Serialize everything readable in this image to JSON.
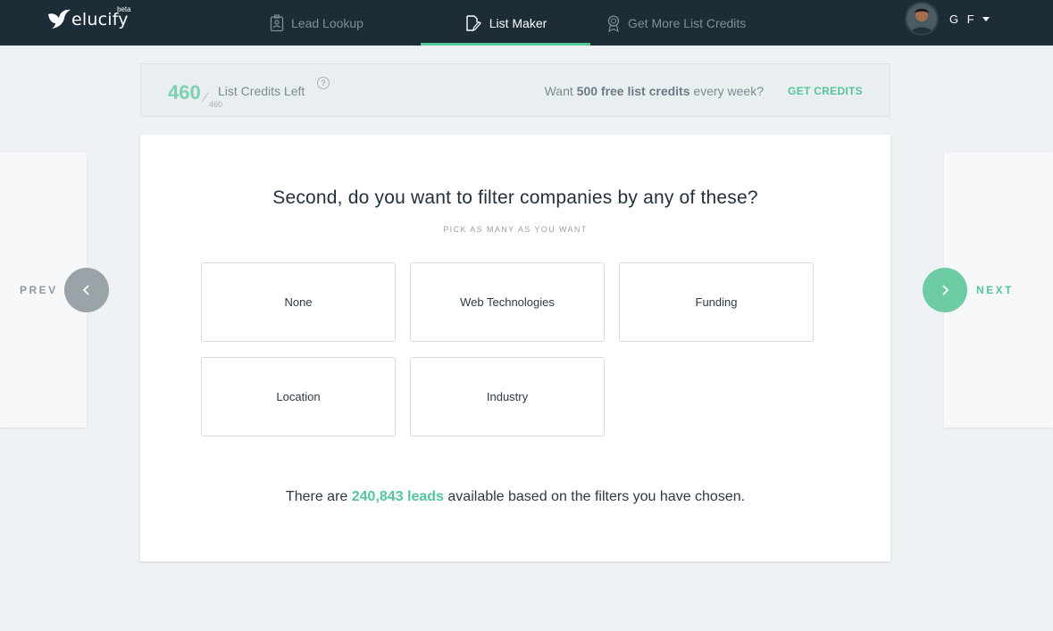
{
  "brand": {
    "name": "elucify",
    "badge": "beta"
  },
  "nav": [
    {
      "label": "Lead Lookup",
      "icon": "badge-icon"
    },
    {
      "label": "List Maker",
      "icon": "edit-list-icon",
      "active": true
    },
    {
      "label": "Get More List Credits",
      "icon": "award-icon"
    }
  ],
  "user": {
    "initials": "G F"
  },
  "credits": {
    "left": "460",
    "total": "460",
    "label": "List Credits Left",
    "help": "?",
    "promo_prefix": "Want",
    "promo_bold": "500 free list credits",
    "promo_suffix": "every week?",
    "cta": "GET CREDITS"
  },
  "pager": {
    "prev": "PREV",
    "next": "NEXT"
  },
  "question": {
    "title": "Second, do you want to filter companies by any of these?",
    "subtitle": "PICK AS MANY AS YOU WANT",
    "options": [
      "None",
      "Web Technologies",
      "Funding",
      "Location",
      "Industry"
    ]
  },
  "summary": {
    "prefix": "There are",
    "leads": "240,843 leads",
    "suffix": "available based on the filters you have chosen."
  },
  "colors": {
    "accent": "#55c59a",
    "nav_bg": "#1d2d37",
    "page_bg": "#eef2f4"
  }
}
